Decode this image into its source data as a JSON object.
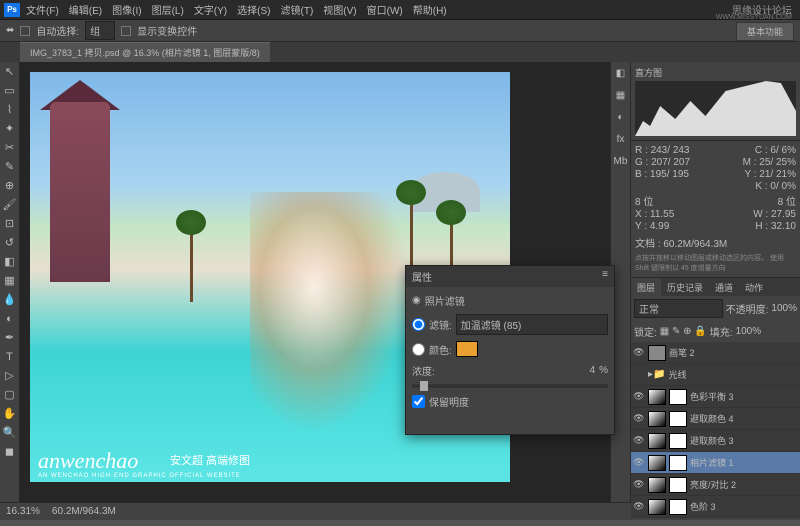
{
  "brand": {
    "name": "思缘设计论坛",
    "url": "WWW.MISSYUAN.COM"
  },
  "menu": [
    "文件(F)",
    "编辑(E)",
    "图像(I)",
    "图层(L)",
    "文字(Y)",
    "选择(S)",
    "滤镜(T)",
    "视图(V)",
    "窗口(W)",
    "帮助(H)"
  ],
  "options": {
    "autoSelect": "自动选择:",
    "group": "组",
    "showTransform": "显示变换控件"
  },
  "featureBtn": "基本功能",
  "tab": "IMG_3783_1 拷贝.psd @ 16.3% (相片滤镜 1, 图层蒙版/8)",
  "histogram": {
    "title": "直方图"
  },
  "infoPanel": {
    "r": {
      "l": "R :",
      "v1": "243/",
      "v2": "243"
    },
    "g": {
      "l": "G :",
      "v1": "207/",
      "v2": "207"
    },
    "b": {
      "l": "B :",
      "v1": "195/",
      "v2": "195"
    },
    "c": {
      "l": "C :",
      "v1": "6/",
      "v2": "6%"
    },
    "m": {
      "l": "M :",
      "v1": "25/",
      "v2": "25%"
    },
    "y": {
      "l": "Y :",
      "v1": "21/",
      "v2": "21%"
    },
    "k": {
      "l": "K :",
      "v1": "0/",
      "v2": "0%"
    },
    "bit1": "8 位",
    "bit2": "8 位",
    "x": {
      "l": "X :",
      "v": "11.55"
    },
    "yc": {
      "l": "Y :",
      "v": "4.99"
    },
    "w": {
      "l": "W :",
      "v": "27.95"
    },
    "h": {
      "l": "H :",
      "v": "32.10"
    },
    "doc": "文档 : 60.2M/964.3M",
    "hint": "点按并拖移以移动图层或移动选区的内容。 使用 Shift 键限制以 45 度增量方向"
  },
  "properties": {
    "title": "属性",
    "type": "照片滤镜",
    "filterLbl": "滤镜:",
    "filterVal": "加温滤镜 (85)",
    "colorLbl": "颜色:",
    "densityLbl": "浓度:",
    "densityVal": "4",
    "densityUnit": "%",
    "preserve": "保留明度"
  },
  "layersPanel": {
    "tabs": [
      "图层",
      "历史记录",
      "通道",
      "动作"
    ],
    "mode": "正常",
    "opacityLbl": "不透明度:",
    "opacity": "100%",
    "lockLbl": "锁定:",
    "fillLbl": "填充:",
    "fill": "100%",
    "layers": [
      {
        "name": "画笔 2",
        "vis": true
      },
      {
        "name": "光线",
        "vis": false,
        "group": true
      },
      {
        "name": "色彩平衡 3",
        "vis": true,
        "adj": true
      },
      {
        "name": "避取颜色 4",
        "vis": true,
        "adj": true
      },
      {
        "name": "避取颜色 3",
        "vis": true,
        "adj": true
      },
      {
        "name": "相片滤镜 1",
        "vis": true,
        "adj": true,
        "sel": true
      },
      {
        "name": "亮度/对比 2",
        "vis": true,
        "adj": true
      },
      {
        "name": "色阶 3",
        "vis": true,
        "adj": true
      }
    ]
  },
  "status": {
    "zoom": "16.31%",
    "doc": "60.2M/964.3M"
  },
  "watermark": {
    "script": "anwenchao",
    "cn": "安文超 高端修图",
    "en": "AN WENCHAO HIGH-END GRAPHIC OFFICIAL WEBSITE"
  }
}
